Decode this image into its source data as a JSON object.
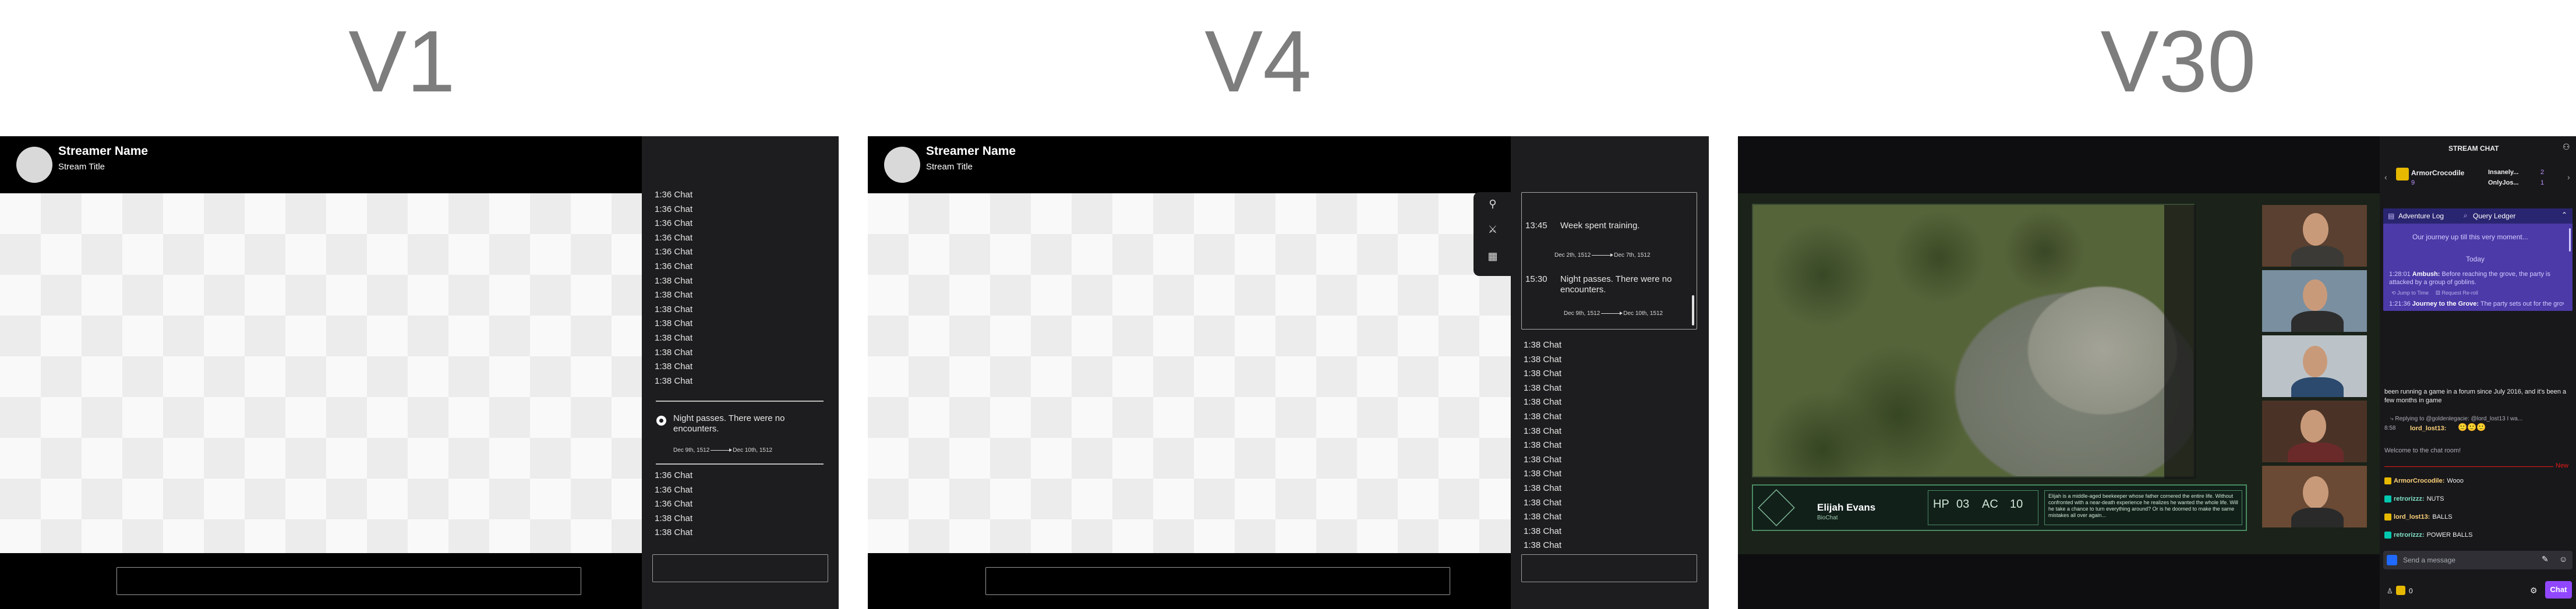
{
  "labels": {
    "v1": "V1",
    "v4": "V4",
    "v30": "V30"
  },
  "header": {
    "streamer_name": "Streamer Name",
    "stream_title": "Stream Title"
  },
  "v1": {
    "chat_top": [
      "1:36 Chat",
      "1:36 Chat",
      "1:36 Chat",
      "1:36 Chat",
      "1:36 Chat",
      "1:36 Chat",
      "1:38 Chat",
      "1:38 Chat",
      "1:38 Chat",
      "1:38 Chat",
      "1:38 Chat",
      "1:38 Chat",
      "1:38 Chat",
      "1:38 Chat"
    ],
    "event": {
      "text": "Night passes. There were no encounters.",
      "date_from": "Dec 9th, 1512",
      "date_to": "Dec 10th, 1512"
    },
    "chat_bottom": [
      "1:36 Chat",
      "1:36 Chat",
      "1:36 Chat",
      "1:38 Chat",
      "1:38 Chat"
    ]
  },
  "v4": {
    "entries": [
      {
        "time": "13:45",
        "text": "Week spent training.",
        "date_from": "Dec 2th, 1512",
        "date_to": "Dec 7th, 1512"
      },
      {
        "time": "15:30",
        "text": "Night passes. There were no encounters.",
        "date_from": "Dec 9th, 1512",
        "date_to": "Dec 10th, 1512"
      }
    ],
    "chat": [
      "1:38 Chat",
      "1:38 Chat",
      "1:38 Chat",
      "1:38 Chat",
      "1:38 Chat",
      "1:38 Chat",
      "1:38 Chat",
      "1:38 Chat",
      "1:38 Chat",
      "1:38 Chat",
      "1:38 Chat",
      "1:38 Chat",
      "1:38 Chat",
      "1:38 Chat",
      "1:38 Chat"
    ]
  },
  "v30": {
    "chat_title": "STREAM CHAT",
    "leaderboard": [
      {
        "name": "ArmorCrocodile",
        "count": "9"
      },
      {
        "name": "Insanely...",
        "count": "2"
      },
      {
        "name": "OnlyJos...",
        "count": "1"
      }
    ],
    "tabs": {
      "adventure_log": "Adventure Log",
      "query_ledger": "Query Ledger"
    },
    "log_intro": "Our journey up till this very moment...",
    "log_day": "Today",
    "log_entries": [
      {
        "time": "1:28:01",
        "title": "Ambush:",
        "text": "Before reaching the grove, the party is attacked by a group of goblins.",
        "jump": "Jump to Time",
        "request": "Request Re-roll"
      },
      {
        "time": "1:21:36",
        "title": "Journey to the Grove:",
        "text": "The party sets out for the grove..."
      }
    ],
    "chat_messages": {
      "long_msg": "been running a game in a forum since July 2016, and it's been a few months in game",
      "reply": "Replying to @goldenlegacie: @lord_lost13 I wa...",
      "reply_time": "8:58",
      "reply_user": "lord_lost13:",
      "welcome": "Welcome to the chat room!",
      "new_label": "New",
      "lines": [
        {
          "user": "ArmorCrocodile:",
          "text": "Wooo"
        },
        {
          "user": "retrorizzz:",
          "text": "NUTS"
        },
        {
          "user": "lord_lost13:",
          "text": "BALLS"
        },
        {
          "user": "retrorizzz:",
          "text": "POWER BALLS"
        }
      ]
    },
    "send_placeholder": "Send a message",
    "points": "0",
    "chat_button": "Chat",
    "character": {
      "name": "Elijah Evans",
      "subtitle": "BioChat",
      "hp_label": "HP",
      "hp": "03",
      "ac_label": "AC",
      "ac": "10",
      "description": "Elijah is a middle-aged beekeeper whose father cornered the entire life. Without confronted with a near-death experience he realizes he wanted the whole life. Will he take a chance to turn everything around? Or is he doomed to make the same mistakes all over again..."
    },
    "colors": {
      "accent": "#9147ff",
      "log_bg": "#4b3aa8",
      "card_border": "#4a8a62"
    }
  }
}
